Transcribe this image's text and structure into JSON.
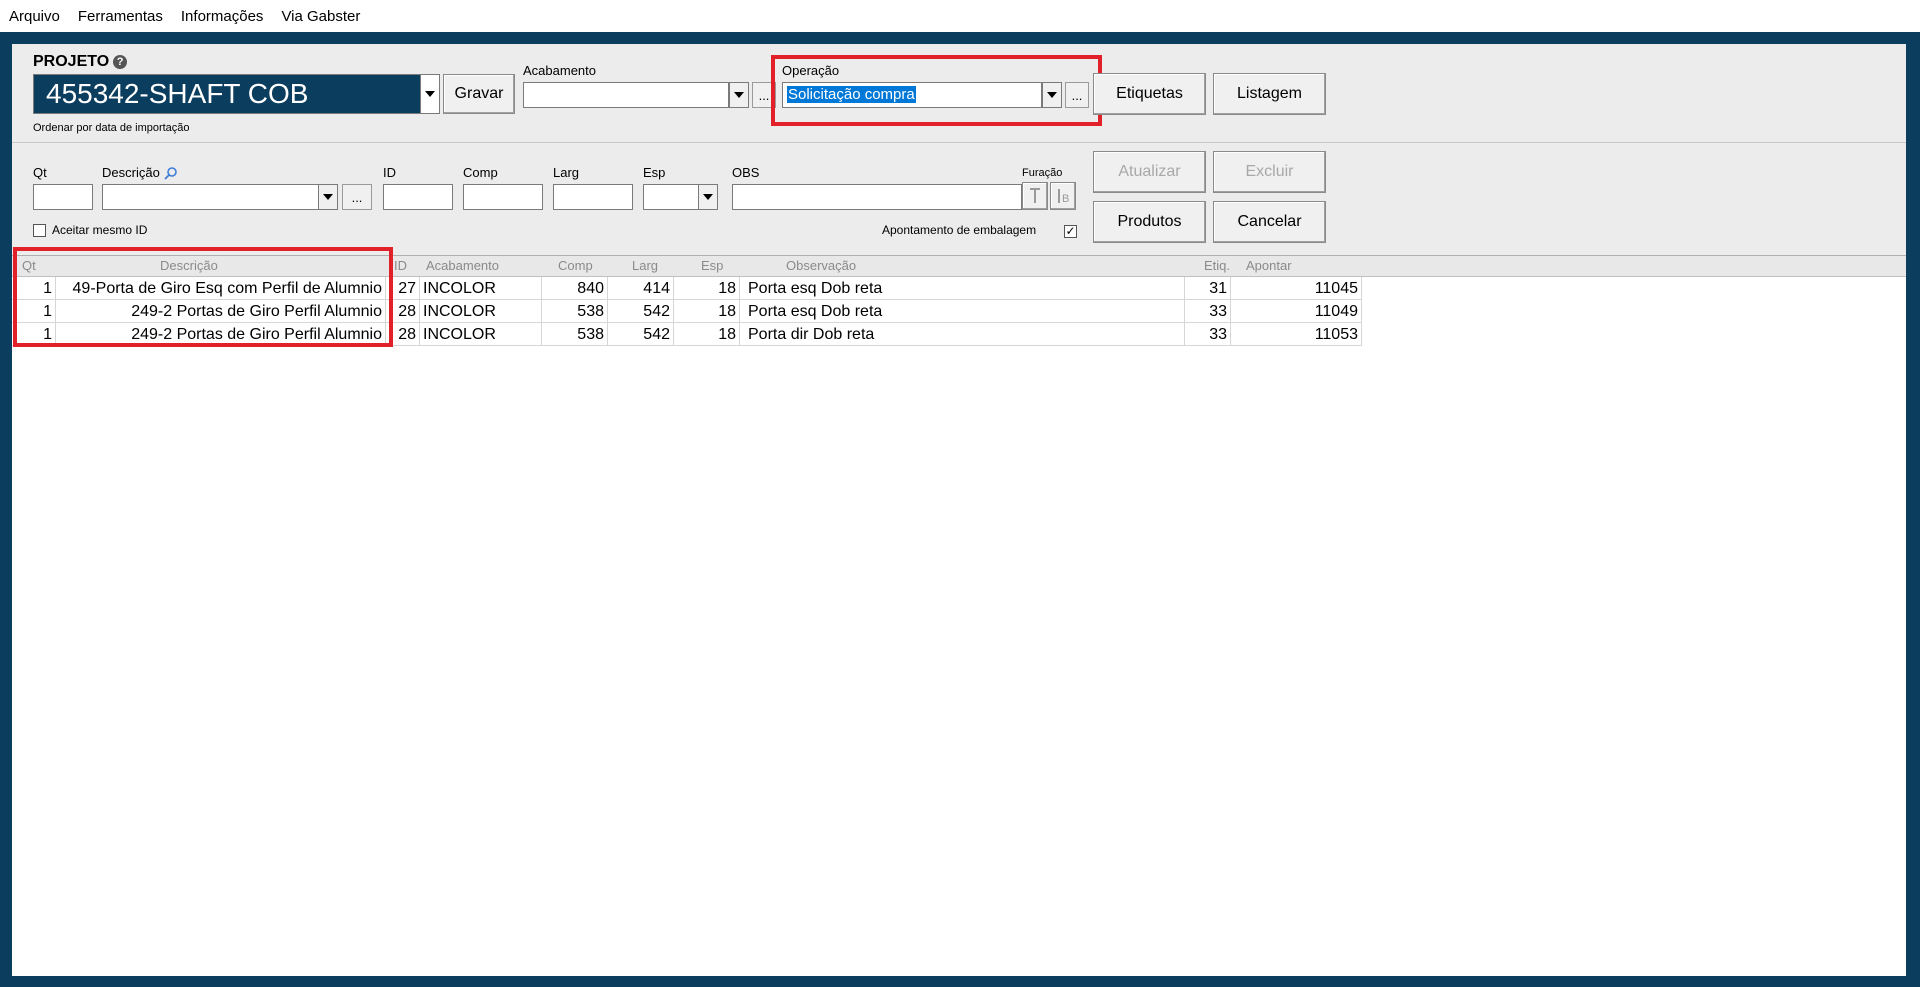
{
  "menu": [
    "Arquivo",
    "Ferramentas",
    "Informações",
    "Via Gabster"
  ],
  "projeto": {
    "label": "PROJETO",
    "value": "455342-SHAFT COB",
    "save_label": "Gravar",
    "sort_note": "Ordenar por data de importação"
  },
  "acabamento": {
    "label": "Acabamento",
    "value": "",
    "more": "..."
  },
  "operacao": {
    "label": "Operação",
    "value": "Solicitação compra",
    "more": "..."
  },
  "top_buttons": {
    "etiquetas": "Etiquetas",
    "listagem": "Listagem"
  },
  "form": {
    "qt": "Qt",
    "descricao": "Descrição",
    "id": "ID",
    "comp": "Comp",
    "larg": "Larg",
    "esp": "Esp",
    "obs": "OBS",
    "furacao": "Furação",
    "more": "...",
    "aceitar": "Aceitar mesmo ID",
    "apontamento": "Apontamento de embalagem",
    "apontamento_checked": "✓"
  },
  "action_buttons": {
    "atualizar": "Atualizar",
    "excluir": "Excluir",
    "produtos": "Produtos",
    "cancelar": "Cancelar"
  },
  "grid": {
    "headers": {
      "qt": "Qt",
      "descricao": "Descrição",
      "id": "ID",
      "acabamento": "Acabamento",
      "comp": "Comp",
      "larg": "Larg",
      "esp": "Esp",
      "observacao": "Observação",
      "etiq": "Etiq.",
      "apontar": "Apontar"
    },
    "rows": [
      {
        "qt": "1",
        "descricao": "49-Porta de Giro Esq com Perfil de Alumnio",
        "id": "27",
        "acabamento": "INCOLOR",
        "comp": "840",
        "larg": "414",
        "esp": "18",
        "observacao": "Porta esq Dob reta",
        "etiq": "31",
        "apontar": "11045"
      },
      {
        "qt": "1",
        "descricao": "249-2 Portas de Giro Perfil Alumnio",
        "id": "28",
        "acabamento": "INCOLOR",
        "comp": "538",
        "larg": "542",
        "esp": "18",
        "observacao": "Porta esq Dob reta",
        "etiq": "33",
        "apontar": "11049"
      },
      {
        "qt": "1",
        "descricao": "249-2 Portas de Giro Perfil Alumnio",
        "id": "28",
        "acabamento": "INCOLOR",
        "comp": "538",
        "larg": "542",
        "esp": "18",
        "observacao": "Porta dir Dob reta",
        "etiq": "33",
        "apontar": "11053"
      }
    ]
  },
  "colors": {
    "frame": "#0b3d5e",
    "projeto_bg": "#0b3d5e",
    "highlight": "#e2202a",
    "selection": "#0078d7"
  }
}
